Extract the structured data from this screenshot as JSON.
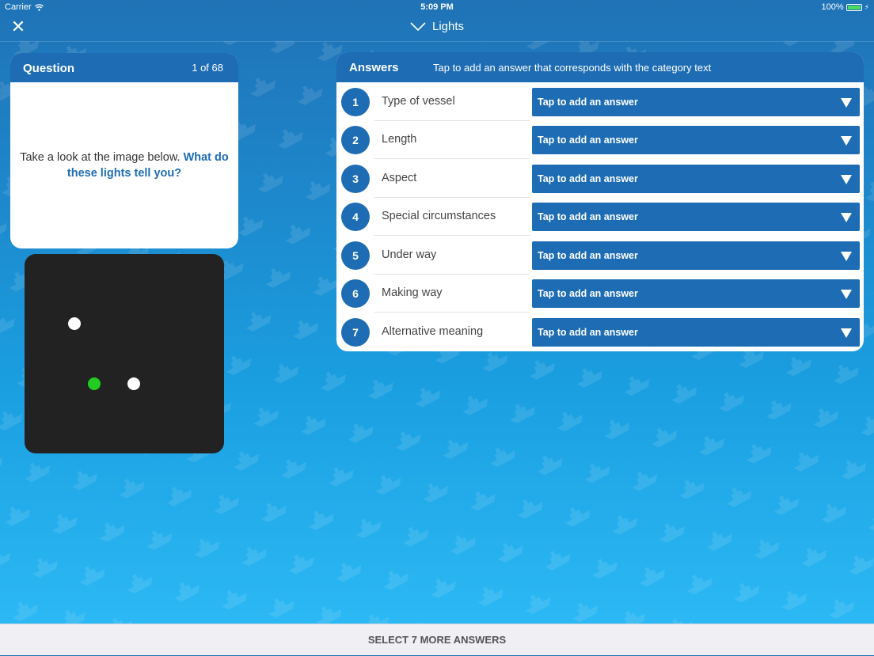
{
  "status_bar": {
    "carrier": "Carrier",
    "time": "5:09 PM",
    "battery": "100%"
  },
  "nav": {
    "title": "Lights",
    "close_icon": "close-icon",
    "chevron_icon": "chevron-down-icon"
  },
  "question": {
    "header": "Question",
    "counter": "1 of 68",
    "text_plain": "Take a look at the image below.",
    "text_highlight": "What do these lights tell you?"
  },
  "lights_image": {
    "background": "#222222",
    "lights": [
      {
        "color": "#ffffff",
        "name": "white-light-top"
      },
      {
        "color": "#22cc22",
        "name": "green-light"
      },
      {
        "color": "#ffffff",
        "name": "white-light-bottom"
      }
    ]
  },
  "answers": {
    "header": "Answers",
    "hint": "Tap to add an answer that corresponds with the category text",
    "rows": [
      {
        "num": "1",
        "label": "Type of vessel",
        "value": "Tap to add an answer"
      },
      {
        "num": "2",
        "label": "Length",
        "value": "Tap to add an answer"
      },
      {
        "num": "3",
        "label": "Aspect",
        "value": "Tap to add an answer"
      },
      {
        "num": "4",
        "label": "Special circumstances",
        "value": "Tap to add an answer"
      },
      {
        "num": "5",
        "label": "Under way",
        "value": "Tap to add an answer"
      },
      {
        "num": "6",
        "label": "Making way",
        "value": "Tap to add an answer"
      },
      {
        "num": "7",
        "label": "Alternative meaning",
        "value": "Tap to add an answer"
      }
    ]
  },
  "footer": {
    "label": "SELECT 7 MORE ANSWERS"
  },
  "colors": {
    "accent": "#1e6cb3",
    "panel": "#ffffff",
    "footer_bg": "#efeff4"
  }
}
